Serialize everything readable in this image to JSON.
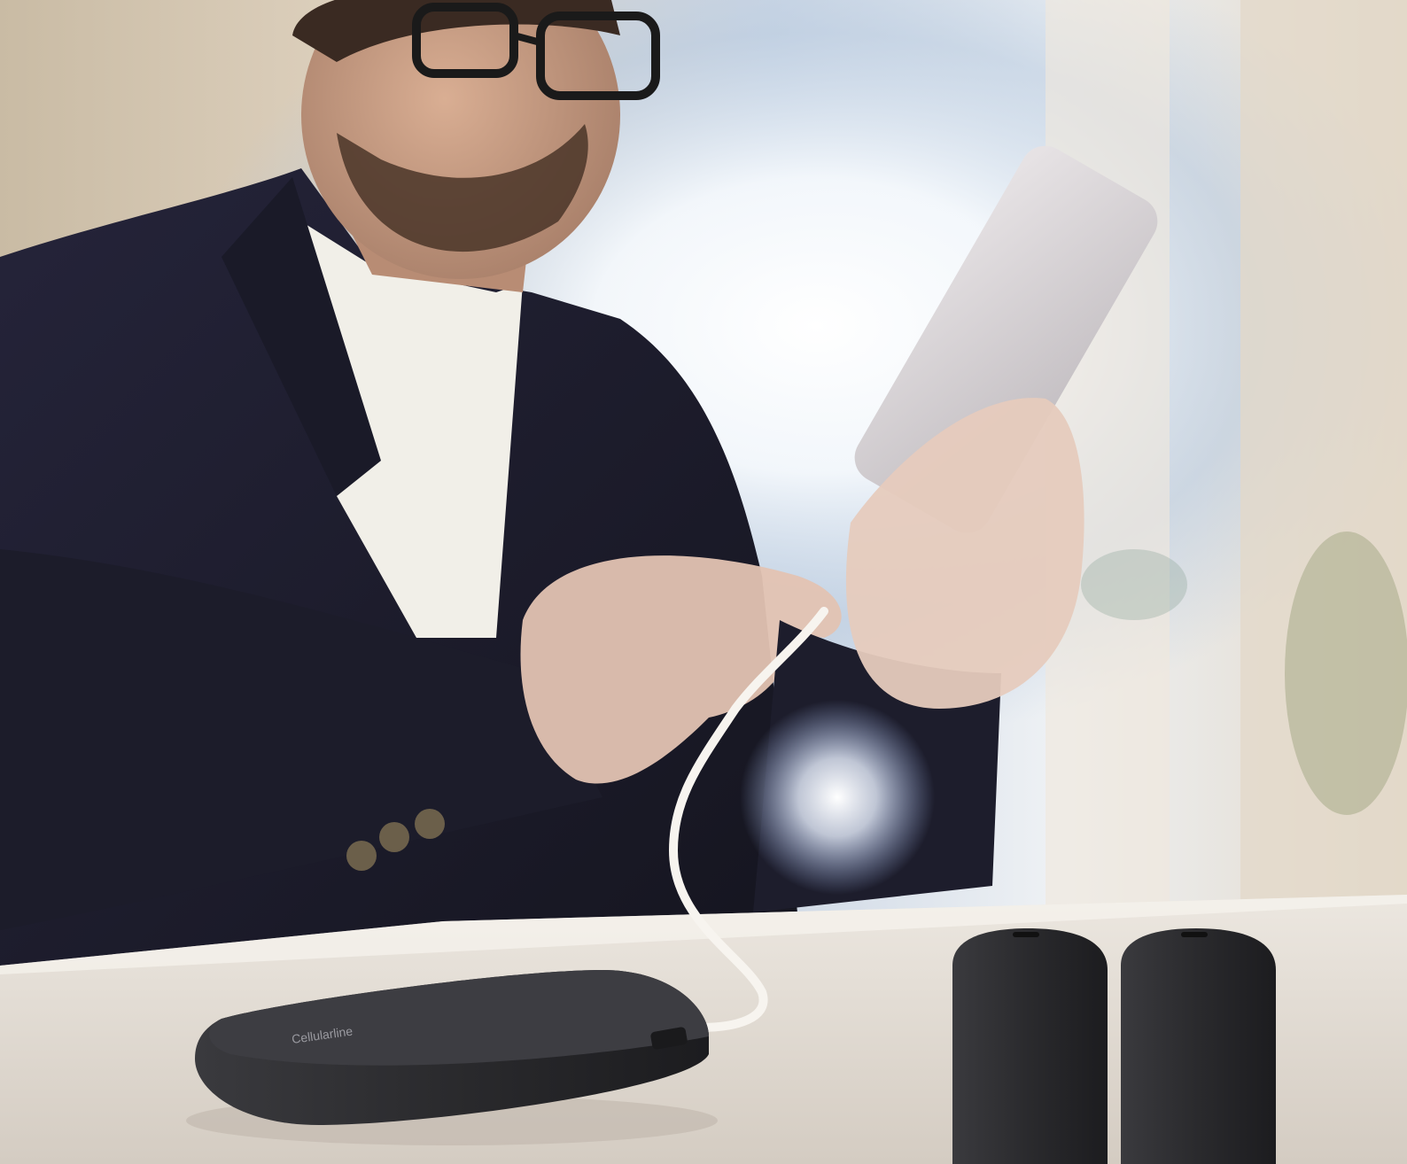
{
  "scene": {
    "kind": "photograph",
    "palette": {
      "wall": "#d9cdb8",
      "window_light": "#f4f7fb",
      "sky_blue": "#9fb8d2",
      "suit": "#1d1d2c",
      "shirt": "#f1efe8",
      "skin": "#c79c83",
      "hair": "#3a2a22",
      "table": "#e6e0d8",
      "table_shadow": "#bfb6ab",
      "power_bank": "#2b2b2e",
      "phone": "#d6d2d4",
      "cable": "#f7f4ef",
      "buttons": "#6b5f4a"
    },
    "objects": {
      "person": "man-in-suit",
      "phone": "smartphone",
      "cable": "charging-cable",
      "power_bank_lying": "power-bank",
      "power_banks_standing": "power-bank-pair"
    },
    "branding": {
      "power_bank_logo": "Cellularline"
    }
  }
}
